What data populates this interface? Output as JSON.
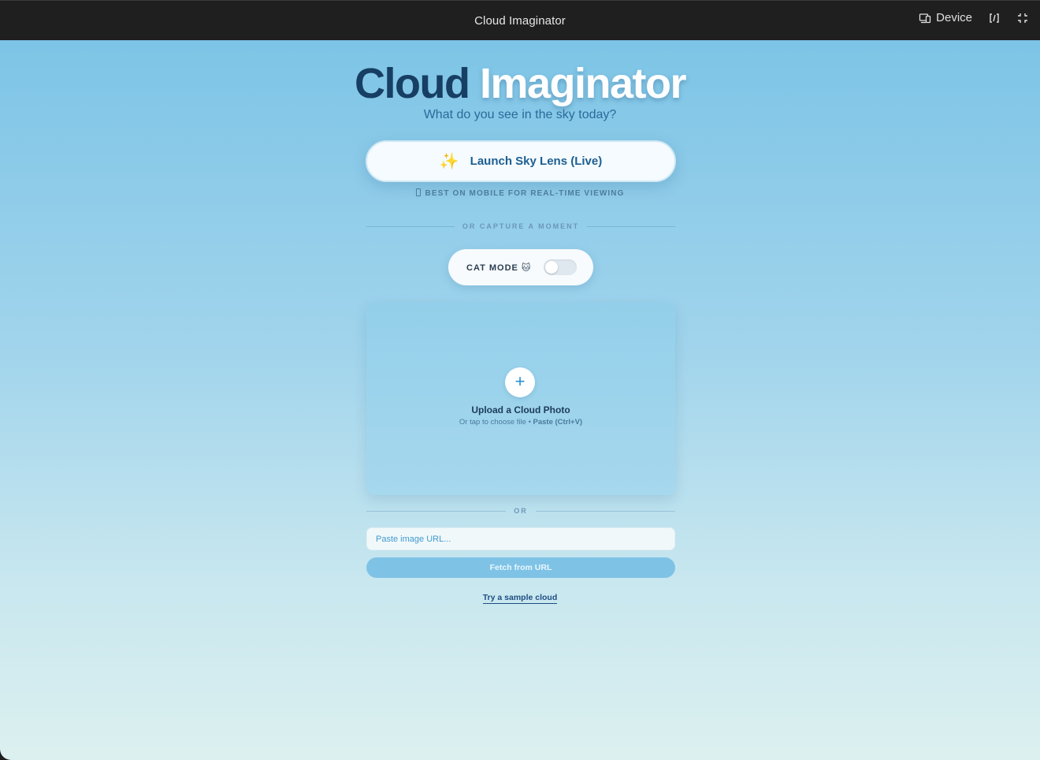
{
  "window": {
    "title": "Cloud Imaginator",
    "device_label": "Device"
  },
  "hero": {
    "title_part1": "Cloud",
    "title_part2": "Imaginator",
    "tagline": "What do you see in the sky today?"
  },
  "launch": {
    "icon": "✨",
    "label": "Launch Sky Lens (Live)",
    "note": "BEST ON MOBILE FOR REAL-TIME VIEWING"
  },
  "divider_capture": "OR CAPTURE A MOMENT",
  "cat_mode": {
    "label": "CAT MODE",
    "emoji": "🐱",
    "enabled": false
  },
  "upload": {
    "plus": "+",
    "title": "Upload a Cloud Photo",
    "sub_prefix": "Or tap to choose file •",
    "sub_paste": "Paste (Ctrl+V)"
  },
  "divider_or": "OR",
  "url": {
    "placeholder": "Paste image URL...",
    "value": ""
  },
  "fetch_label": "Fetch from URL",
  "sample_label": "Try a sample cloud",
  "colors": {
    "brand_dark": "#173e63",
    "accent": "#2a8fcf",
    "sky_top": "#7dc4e6",
    "sky_bottom": "#dcf0ef"
  }
}
